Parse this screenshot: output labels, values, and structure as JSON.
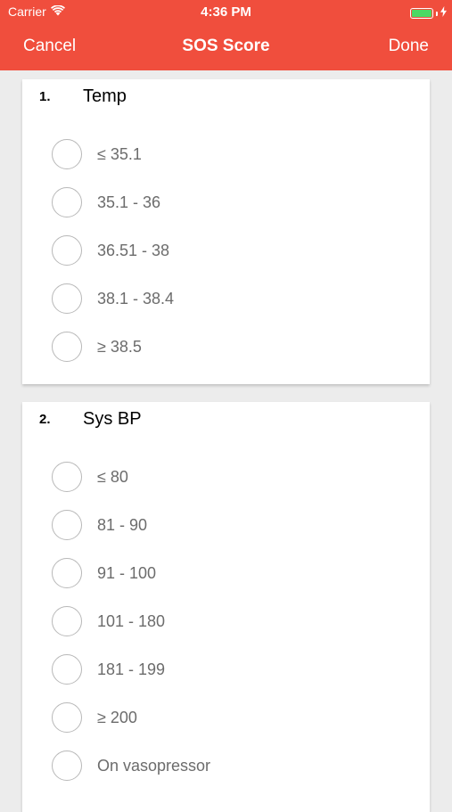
{
  "status_bar": {
    "carrier": "Carrier",
    "time": "4:36 PM",
    "wifi_icon": "wifi-icon",
    "battery_icon": "battery-icon",
    "charging_icon": "bolt-icon"
  },
  "nav": {
    "cancel_label": "Cancel",
    "title": "SOS Score",
    "done_label": "Done"
  },
  "colors": {
    "header": "#f04e3d",
    "background": "#ececec",
    "battery_fill": "#4cd964"
  },
  "questions": [
    {
      "number": "1.",
      "title": "Temp",
      "options": [
        "≤ 35.1",
        "35.1 - 36",
        "36.51 - 38",
        "38.1 - 38.4",
        "≥ 38.5"
      ]
    },
    {
      "number": "2.",
      "title": "Sys BP",
      "options": [
        "≤ 80",
        "81 - 90",
        "91 - 100",
        "101 - 180",
        "181 - 199",
        "≥ 200",
        "On vasopressor"
      ]
    }
  ]
}
